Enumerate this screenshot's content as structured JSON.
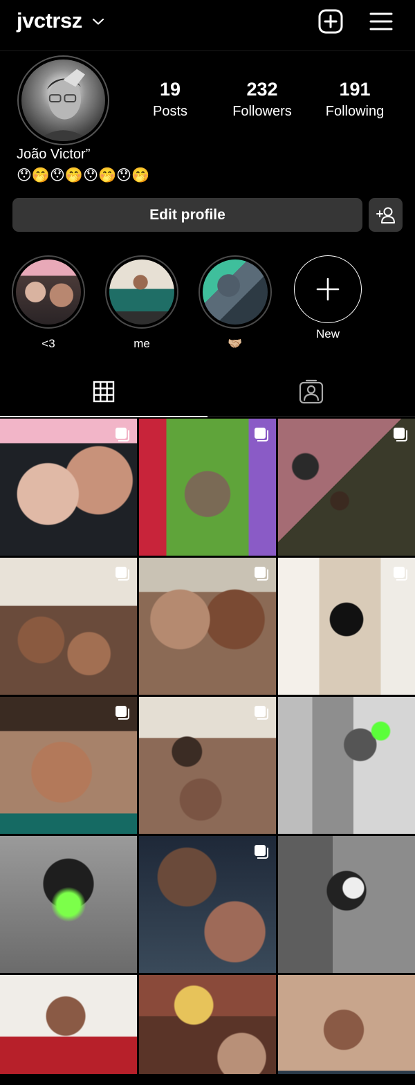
{
  "header": {
    "username": "jvctrsz",
    "icons": [
      "chevron-down-icon",
      "plus-square-icon",
      "hamburger-menu-icon"
    ]
  },
  "profile": {
    "display_name": "João Victor”",
    "bio_emoji": "😯🤭😯🤭😯🤭😯🤭",
    "stats": [
      {
        "value": "19",
        "label": "Posts"
      },
      {
        "value": "232",
        "label": "Followers"
      },
      {
        "value": "191",
        "label": "Following"
      }
    ],
    "edit_profile_label": "Edit profile"
  },
  "highlights": [
    {
      "label": "<3"
    },
    {
      "label": "me"
    },
    {
      "label": "🤝🏼"
    },
    {
      "label": "New"
    }
  ],
  "tabs": [
    "grid-icon",
    "tagged-icon"
  ],
  "colors": {
    "background": "#000000",
    "button_bg": "#363636",
    "text": "#ffffff"
  }
}
